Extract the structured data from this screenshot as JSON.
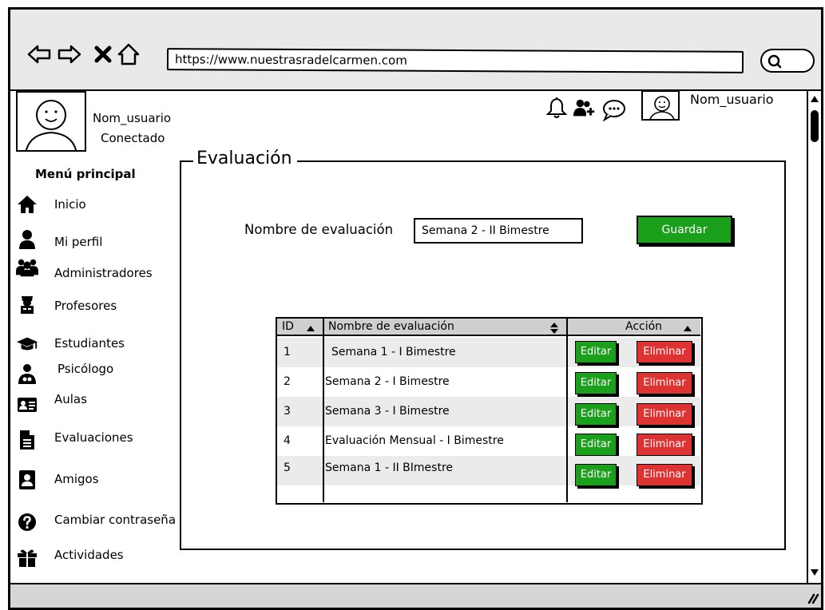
{
  "browser": {
    "url": "https://www.nuestrasradelcarmen.com"
  },
  "user": {
    "name": "Nom_usuario",
    "status": "Conectado"
  },
  "sidebar": {
    "title": "Menú principal",
    "items": [
      {
        "label": "Inicio",
        "icon": "home-icon"
      },
      {
        "label": "Mi perfil",
        "icon": "user-icon"
      },
      {
        "label": "Administradores",
        "icon": "users-group-icon"
      },
      {
        "label": "Profesores",
        "icon": "teacher-icon"
      },
      {
        "label": "Estudiantes",
        "icon": "graduation-cap-icon"
      },
      {
        "label": "Psicólogo",
        "icon": "doctor-icon"
      },
      {
        "label": "Aulas",
        "icon": "id-card-icon"
      },
      {
        "label": "Evaluaciones",
        "icon": "document-icon"
      },
      {
        "label": "Amigos",
        "icon": "contact-book-icon"
      },
      {
        "label": "Cambiar contraseña",
        "icon": "question-icon"
      },
      {
        "label": "Actividades",
        "icon": "gift-icon"
      }
    ]
  },
  "header": {
    "icons": [
      "bell-icon",
      "add-user-icon",
      "chat-icon"
    ],
    "username": "Nom_usuario"
  },
  "main": {
    "title": "Evaluación",
    "form": {
      "label": "Nombre de evaluación",
      "value": "Semana 2 - II Bimestre",
      "save_label": "Guardar"
    },
    "table": {
      "headers": {
        "id": "ID",
        "name": "Nombre de evaluación",
        "action": "Acción"
      },
      "rows": [
        {
          "id": "1",
          "name": "Semana 1 - I Bimestre"
        },
        {
          "id": "2",
          "name": "Semana 2 - I Bimestre"
        },
        {
          "id": "3",
          "name": "Semana 3 - I Bimestre"
        },
        {
          "id": "4",
          "name": "Evaluación Mensual - I Bimestre"
        },
        {
          "id": "5",
          "name": "Semana 1 - II BImestre"
        }
      ],
      "edit_label": "Editar",
      "delete_label": "Eliminar"
    }
  },
  "colors": {
    "accent_green": "#1aa01a",
    "danger_red": "#dd3333",
    "chrome_gray": "#e9e9e9"
  }
}
